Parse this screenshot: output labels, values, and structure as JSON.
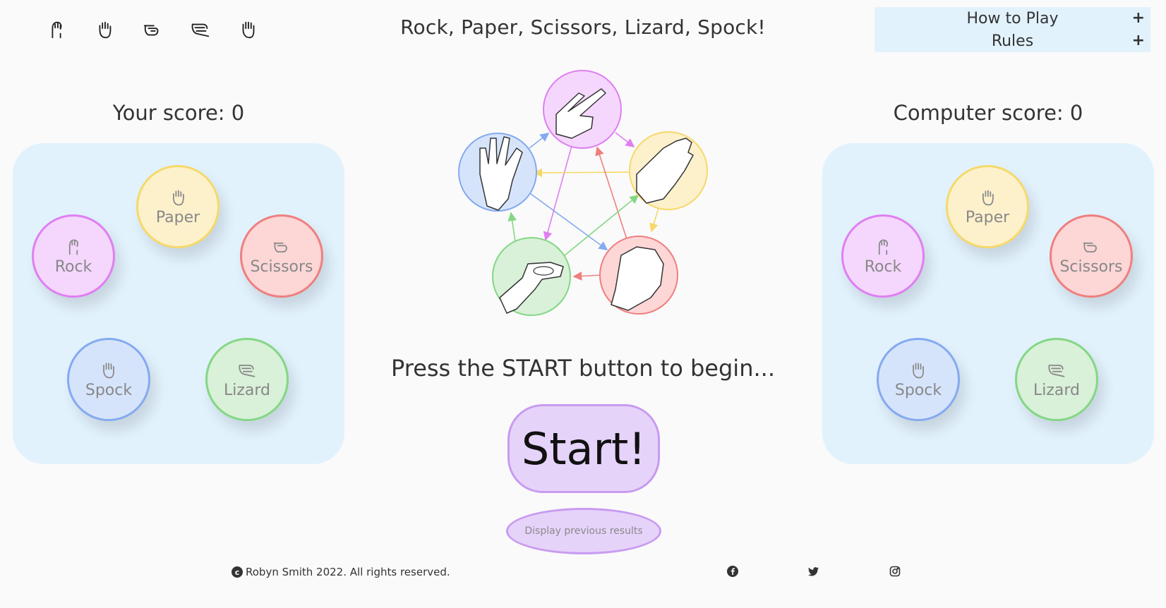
{
  "header": {
    "title": "Rock, Paper, Scissors, Lizard, Spock!",
    "icons": [
      "rock-icon",
      "paper-icon",
      "scissors-icon",
      "lizard-icon",
      "spock-icon"
    ]
  },
  "dropdown": {
    "how_to_play": "How to Play",
    "rules": "Rules",
    "toggle": "+"
  },
  "player": {
    "score_label": "Your score: 0",
    "choices": [
      "Rock",
      "Paper",
      "Scissors",
      "Spock",
      "Lizard"
    ]
  },
  "computer": {
    "score_label": "Computer score: 0",
    "choices": [
      "Rock",
      "Paper",
      "Scissors",
      "Spock",
      "Lizard"
    ]
  },
  "colors": {
    "rock": "#df7ff2",
    "paper": "#f6d96a",
    "scissors": "#ef7f7f",
    "spock": "#84aaf0",
    "lizard": "#84d784",
    "panel": "#e2f2fd",
    "button": "#e6d3fa"
  },
  "main": {
    "prompt": "Press the START button to begin...",
    "start_label": "Start!",
    "previous_results_label": "Display previous results"
  },
  "footer": {
    "copyright": "Robyn Smith 2022. All rights reserved.",
    "social": [
      "facebook-icon",
      "twitter-icon",
      "instagram-icon"
    ]
  }
}
